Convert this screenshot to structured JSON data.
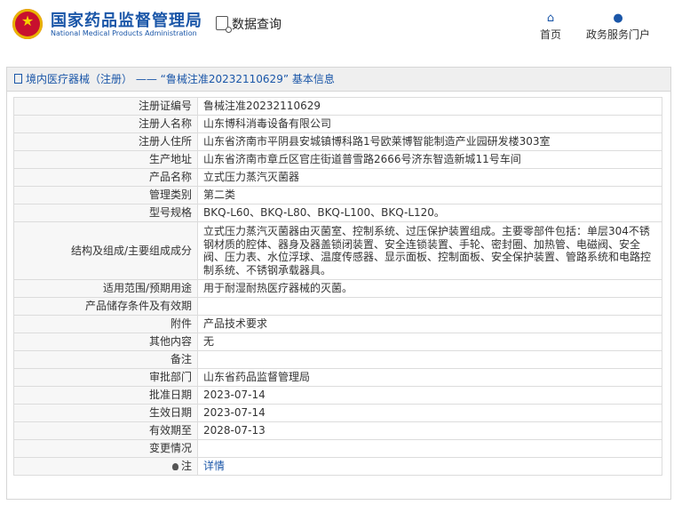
{
  "header": {
    "site_title": "国家药品监督管理局",
    "site_subtitle": "National Medical Products Administration",
    "query_label": "数据查询",
    "nav": [
      {
        "label": "首页",
        "icon": "home-icon"
      },
      {
        "label": "政务服务门户",
        "icon": "user-icon"
      }
    ]
  },
  "panel": {
    "title": "境内医疗器械（注册） —— “鲁械注准20232110629” 基本信息"
  },
  "rows": [
    {
      "label": "注册证编号",
      "value": "鲁械注准20232110629"
    },
    {
      "label": "注册人名称",
      "value": "山东博科消毒设备有限公司"
    },
    {
      "label": "注册人住所",
      "value": "山东省济南市平阴县安城镇博科路1号欧莱博智能制造产业园研发楼303室"
    },
    {
      "label": "生产地址",
      "value": "山东省济南市章丘区官庄街道普雪路2666号济东智造新城11号车间"
    },
    {
      "label": "产品名称",
      "value": "立式压力蒸汽灭菌器"
    },
    {
      "label": "管理类别",
      "value": "第二类"
    },
    {
      "label": "型号规格",
      "value": "BKQ-L60、BKQ-L80、BKQ-L100、BKQ-L120。"
    },
    {
      "label": "结构及组成/主要组成成分",
      "value": "立式压力蒸汽灭菌器由灭菌室、控制系统、过压保护装置组成。主要零部件包括：单层304不锈钢材质的腔体、器身及器盖锁闭装置、安全连锁装置、手轮、密封圈、加热管、电磁阀、安全阀、压力表、水位浮球、温度传感器、显示面板、控制面板、安全保护装置、管路系统和电路控制系统、不锈钢承载器具。"
    },
    {
      "label": "适用范围/预期用途",
      "value": "用于耐湿耐热医疗器械的灭菌。"
    },
    {
      "label": "产品储存条件及有效期",
      "value": ""
    },
    {
      "label": "附件",
      "value": "产品技术要求"
    },
    {
      "label": "其他内容",
      "value": "无"
    },
    {
      "label": "备注",
      "value": ""
    },
    {
      "label": "审批部门",
      "value": "山东省药品监督管理局"
    },
    {
      "label": "批准日期",
      "value": "2023-07-14"
    },
    {
      "label": "生效日期",
      "value": "2023-07-14"
    },
    {
      "label": "有效期至",
      "value": "2028-07-13"
    },
    {
      "label": "变更情况",
      "value": ""
    },
    {
      "label": "注",
      "value": "详情"
    }
  ]
}
